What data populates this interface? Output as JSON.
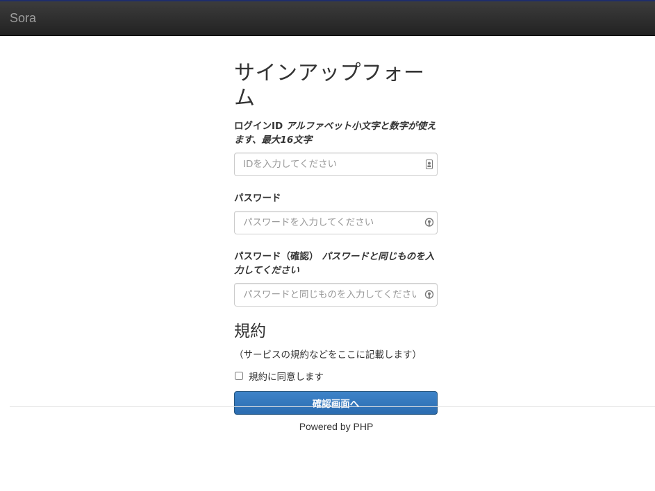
{
  "navbar": {
    "brand": "Sora"
  },
  "form": {
    "title": "サインアップフォーム",
    "login_id": {
      "label": "ログインID",
      "hint": "アルファベット小文字と数字が使えます、最大16文字",
      "placeholder": "IDを入力してください",
      "icon": "contact-card-icon"
    },
    "password": {
      "label": "パスワード",
      "placeholder": "パスワードを入力してください",
      "icon": "key-icon"
    },
    "password_confirm": {
      "label": "パスワード（確認）",
      "hint": "パスワードと同じものを入力してください",
      "placeholder": "パスワードと同じものを入力してください",
      "icon": "key-icon"
    },
    "terms": {
      "title": "規約",
      "text": "（サービスの規約などをここに記載します）",
      "agree_label": "規約に同意します",
      "agree_checked": false
    },
    "submit_label": "確認画面へ"
  },
  "footer": {
    "text": "Powered by PHP"
  },
  "colors": {
    "navbar_bg": "#222222",
    "brand_text": "#9d9d9d",
    "primary": "#337ab7"
  }
}
